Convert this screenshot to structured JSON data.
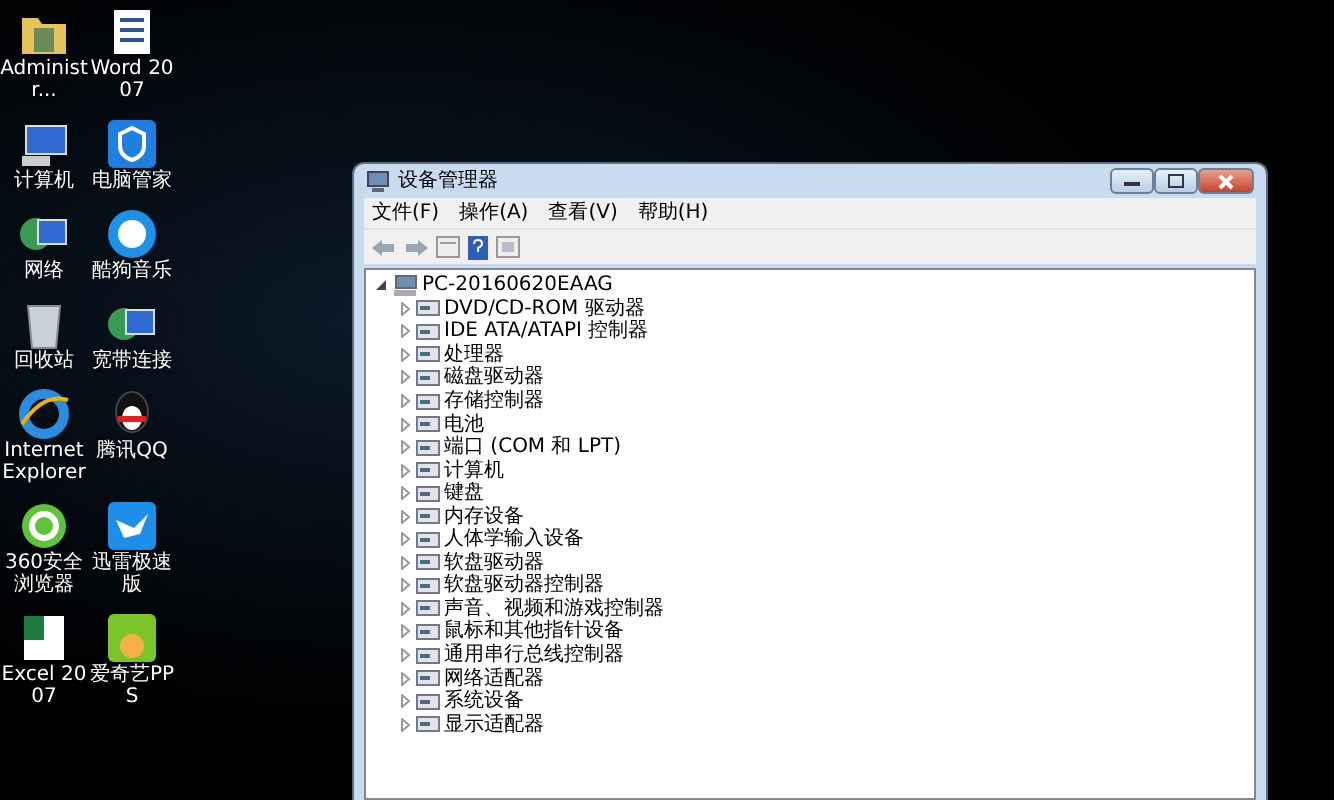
{
  "desktop": {
    "icons": [
      {
        "label": "Administr...",
        "kind": "folder"
      },
      {
        "label": "Word 2007",
        "kind": "word"
      },
      {
        "label": "计算机",
        "kind": "computer"
      },
      {
        "label": "电脑管家",
        "kind": "shield"
      },
      {
        "label": "网络",
        "kind": "network"
      },
      {
        "label": "酷狗音乐",
        "kind": "music"
      },
      {
        "label": "回收站",
        "kind": "bin"
      },
      {
        "label": "宽带连接",
        "kind": "network"
      },
      {
        "label": "Internet Explorer",
        "kind": "ie"
      },
      {
        "label": "腾讯QQ",
        "kind": "penguin"
      },
      {
        "label": "360安全浏览器",
        "kind": "ie360"
      },
      {
        "label": "迅雷极速版",
        "kind": "bird"
      },
      {
        "label": "Excel 2007",
        "kind": "excel"
      },
      {
        "label": "爱奇艺PPS",
        "kind": "video"
      }
    ]
  },
  "window": {
    "title": "设备管理器",
    "menu": [
      "文件(F)",
      "操作(A)",
      "查看(V)",
      "帮助(H)"
    ],
    "tree": {
      "label": "PC-20160620EAAG",
      "expanded": true,
      "children": [
        {
          "label": "DVD/CD-ROM 驱动器",
          "expanded": false
        },
        {
          "label": "IDE ATA/ATAPI 控制器",
          "expanded": false
        },
        {
          "label": "处理器",
          "expanded": false
        },
        {
          "label": "磁盘驱动器",
          "expanded": false
        },
        {
          "label": "存储控制器",
          "expanded": false
        },
        {
          "label": "电池",
          "expanded": false
        },
        {
          "label": "端口 (COM 和 LPT)",
          "expanded": false
        },
        {
          "label": "计算机",
          "expanded": false
        },
        {
          "label": "键盘",
          "expanded": false
        },
        {
          "label": "内存设备",
          "expanded": false
        },
        {
          "label": "人体学输入设备",
          "expanded": false
        },
        {
          "label": "软盘驱动器",
          "expanded": false
        },
        {
          "label": "软盘驱动器控制器",
          "expanded": false
        },
        {
          "label": "声音、视频和游戏控制器",
          "expanded": false
        },
        {
          "label": "鼠标和其他指针设备",
          "expanded": false
        },
        {
          "label": "通用串行总线控制器",
          "expanded": false
        },
        {
          "label": "网络适配器",
          "expanded": false
        },
        {
          "label": "系统设备",
          "expanded": false
        },
        {
          "label": "显示适配器",
          "expanded": false
        }
      ]
    }
  }
}
